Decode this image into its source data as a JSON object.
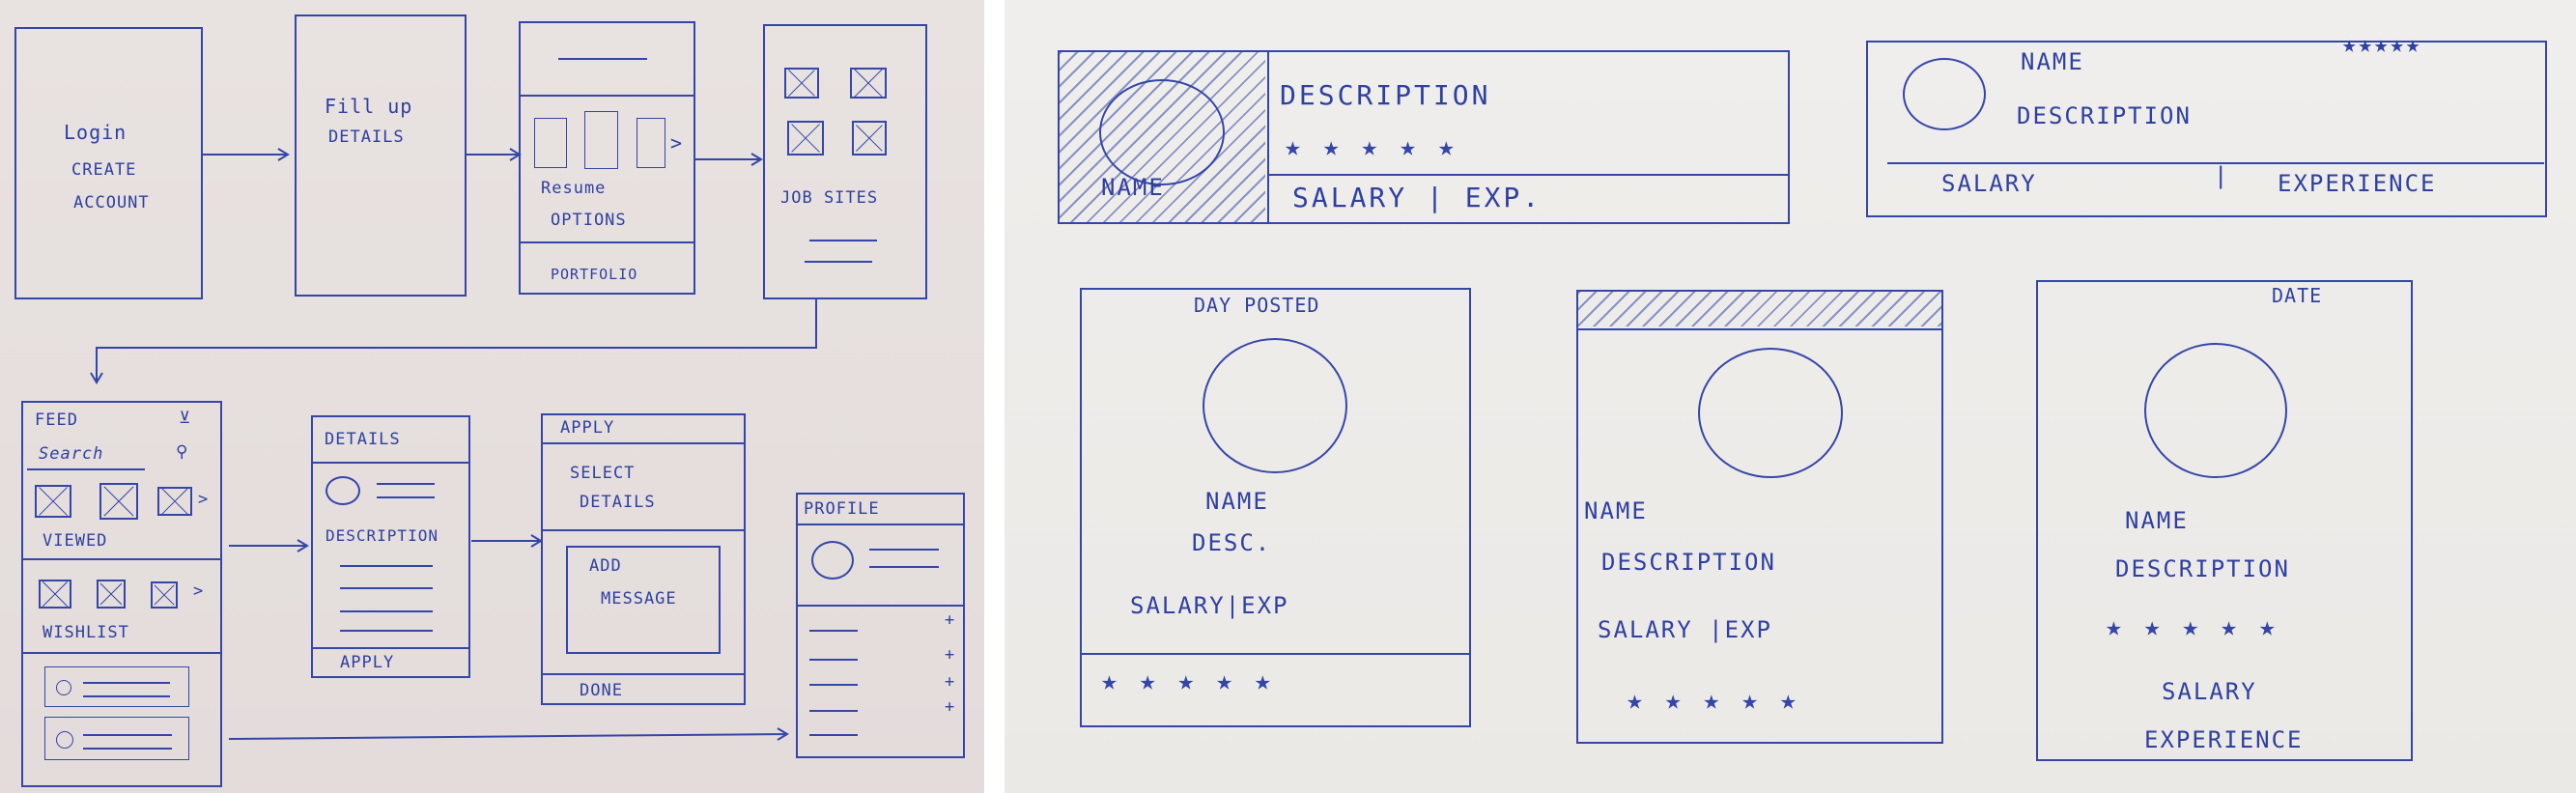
{
  "flow": {
    "login": {
      "line1": "Login",
      "line2": "CREATE",
      "line3": "ACCOUNT"
    },
    "fill": {
      "line1": "Fill up",
      "line2": "DETAILS"
    },
    "resume": {
      "line1": "Resume",
      "line2": "OPTIONS",
      "footer": "PORTFOLIO"
    },
    "jobs": {
      "label": "JOB SITES"
    },
    "feed": {
      "title": "FEED",
      "search": "Search",
      "viewed": "VIEWED",
      "wishlist": "WISHLIST"
    },
    "details": {
      "title": "DETAILS",
      "desc": "DESCRIPTION",
      "apply": "APPLY"
    },
    "apply": {
      "title": "APPLY",
      "select1": "SELECT",
      "select2": "DETAILS",
      "msg1": "ADD",
      "msg2": "MESSAGE",
      "done": "DONE"
    },
    "profile": {
      "title": "PROFILE"
    }
  },
  "cards": {
    "card1": {
      "name": "NAME",
      "desc": "DESCRIPTION",
      "stars": "★ ★ ★ ★ ★",
      "salary_exp": "SALARY  |  EXP."
    },
    "card2": {
      "name": "NAME",
      "desc": "DESCRIPTION",
      "stars": "★★★★★",
      "salary": "SALARY",
      "sep": "|",
      "exp": "EXPERIENCE"
    },
    "card3": {
      "day": "DAY POSTED",
      "name": "NAME",
      "desc": "DESC.",
      "salary_exp": "SALARY|EXP",
      "stars": "★  ★  ★  ★  ★"
    },
    "card4": {
      "name": "NAME",
      "desc": "DESCRIPTION",
      "salary_exp": "SALARY |EXP",
      "stars": "★ ★ ★ ★ ★"
    },
    "card5": {
      "date": "DATE",
      "name": "NAME",
      "desc": "DESCRIPTION",
      "stars": "★  ★  ★  ★  ★",
      "salary": "SALARY",
      "exp": "EXPERIENCE"
    }
  }
}
